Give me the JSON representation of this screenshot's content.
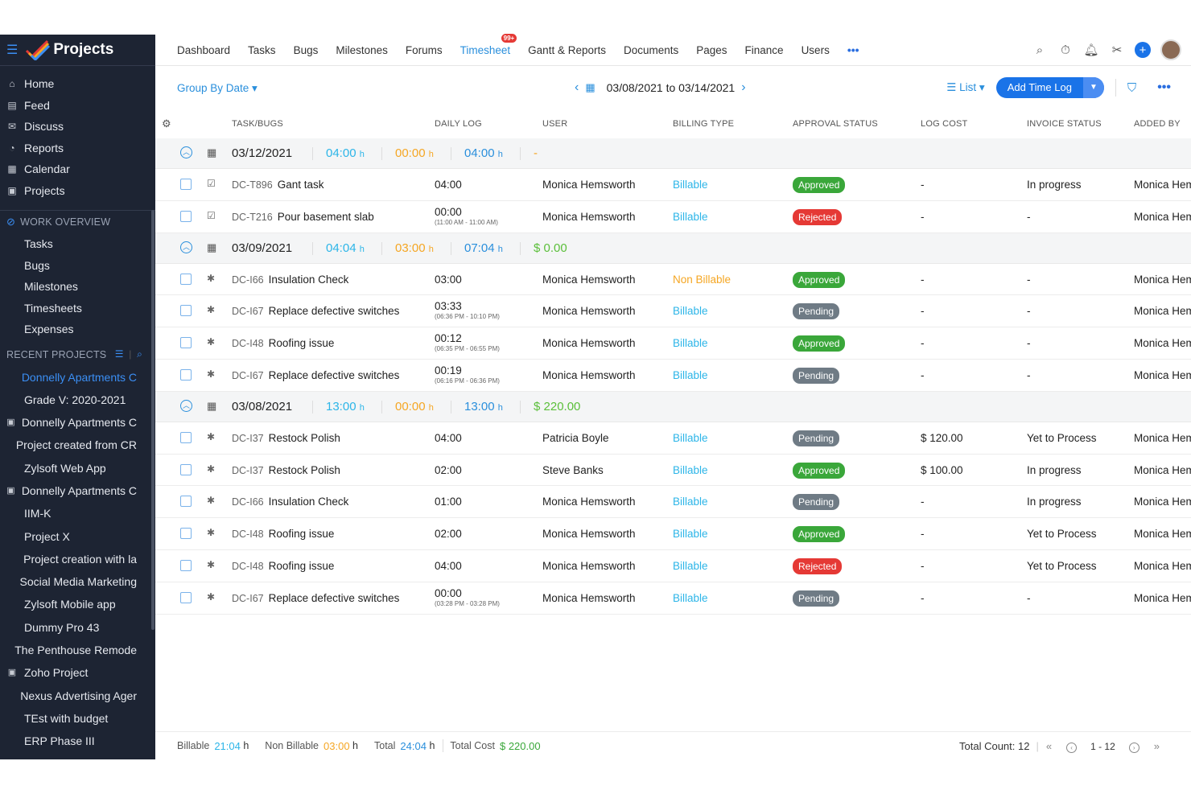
{
  "app": {
    "title": "Projects"
  },
  "sidebar": {
    "main_items": [
      {
        "icon": "home-icon",
        "label": "Home"
      },
      {
        "icon": "feed-icon",
        "label": "Feed"
      },
      {
        "icon": "discuss-icon",
        "label": "Discuss"
      },
      {
        "icon": "reports-icon",
        "label": "Reports"
      },
      {
        "icon": "calendar-icon",
        "label": "Calendar"
      },
      {
        "icon": "projects-icon",
        "label": "Projects"
      }
    ],
    "work_overview_label": "WORK OVERVIEW",
    "work_items": [
      "Tasks",
      "Bugs",
      "Milestones",
      "Timesheets",
      "Expenses"
    ],
    "recent_projects_label": "RECENT PROJECTS",
    "recent_projects": [
      {
        "label": "Donnelly Apartments C",
        "icon": "",
        "active": true
      },
      {
        "label": "Grade V: 2020-2021",
        "icon": ""
      },
      {
        "label": "Donnelly Apartments C",
        "icon": "project-icon"
      },
      {
        "label": "Project created from CR",
        "icon": ""
      },
      {
        "label": "Zylsoft Web App",
        "icon": ""
      },
      {
        "label": "Donnelly Apartments C",
        "icon": "project-icon"
      },
      {
        "label": "IIM-K",
        "icon": ""
      },
      {
        "label": "Project X",
        "icon": ""
      },
      {
        "label": "Project creation with la",
        "icon": ""
      },
      {
        "label": "Social Media Marketing",
        "icon": ""
      },
      {
        "label": "Zylsoft Mobile app",
        "icon": ""
      },
      {
        "label": "Dummy Pro 43",
        "icon": ""
      },
      {
        "label": "The Penthouse Remode",
        "icon": ""
      },
      {
        "label": "Zoho Project",
        "icon": "project-icon"
      },
      {
        "label": "Nexus Advertising Ager",
        "icon": ""
      },
      {
        "label": "TEst with budget",
        "icon": ""
      },
      {
        "label": "ERP Phase III",
        "icon": ""
      }
    ]
  },
  "topnav": {
    "tabs": [
      "Dashboard",
      "Tasks",
      "Bugs",
      "Milestones",
      "Forums",
      "Timesheet",
      "Gantt & Reports",
      "Documents",
      "Pages",
      "Finance",
      "Users"
    ],
    "active_tab": "Timesheet",
    "timesheet_badge": "99+",
    "more": "•••"
  },
  "toolbar": {
    "group_by": "Group By Date ▾",
    "date_range": "03/08/2021 to 03/14/2021",
    "view": "List ▾",
    "add_button": "Add Time Log",
    "more": "•••"
  },
  "table": {
    "columns": [
      "TASK/BUGS",
      "DAILY LOG",
      "USER",
      "BILLING TYPE",
      "APPROVAL STATUS",
      "LOG COST",
      "INVOICE STATUS",
      "ADDED BY"
    ],
    "groups": [
      {
        "date": "03/12/2021",
        "billable": "04:00",
        "non_billable": "00:00",
        "total": "04:00",
        "cost": "-",
        "rows": [
          {
            "icon": "task-icon",
            "id": "DC-T896",
            "name": "Gant task",
            "log": "04:00",
            "log_range": "",
            "user": "Monica Hemsworth",
            "billing": "Billable",
            "approval": "Approved",
            "cost": "-",
            "invoice": "In progress",
            "added_by": "Monica Hemsworth"
          },
          {
            "icon": "task-icon",
            "id": "DC-T216",
            "name": "Pour basement slab",
            "log": "00:00",
            "log_range": "(11:00 AM - 11:00 AM)",
            "user": "Monica Hemsworth",
            "billing": "Billable",
            "approval": "Rejected",
            "cost": "-",
            "invoice": "-",
            "added_by": "Monica Hemsworth"
          }
        ]
      },
      {
        "date": "03/09/2021",
        "billable": "04:04",
        "non_billable": "03:00",
        "total": "07:04",
        "cost": "$ 0.00",
        "rows": [
          {
            "icon": "bug-icon",
            "id": "DC-I66",
            "name": "Insulation Check",
            "log": "03:00",
            "log_range": "",
            "user": "Monica Hemsworth",
            "billing": "Non Billable",
            "approval": "Approved",
            "cost": "-",
            "invoice": "-",
            "added_by": "Monica Hemsworth"
          },
          {
            "icon": "bug-icon",
            "id": "DC-I67",
            "name": "Replace defective switches",
            "log": "03:33",
            "log_range": "(06:36 PM - 10:10 PM)",
            "user": "Monica Hemsworth",
            "billing": "Billable",
            "approval": "Pending",
            "cost": "-",
            "invoice": "-",
            "added_by": "Monica Hemsworth"
          },
          {
            "icon": "bug-icon",
            "id": "DC-I48",
            "name": "Roofing issue",
            "log": "00:12",
            "log_range": "(06:35 PM - 06:55 PM)",
            "user": "Monica Hemsworth",
            "billing": "Billable",
            "approval": "Approved",
            "cost": "-",
            "invoice": "-",
            "added_by": "Monica Hemsworth"
          },
          {
            "icon": "bug-icon",
            "id": "DC-I67",
            "name": "Replace defective switches",
            "log": "00:19",
            "log_range": "(06:16 PM - 06:36 PM)",
            "user": "Monica Hemsworth",
            "billing": "Billable",
            "approval": "Pending",
            "cost": "-",
            "invoice": "-",
            "added_by": "Monica Hemsworth"
          }
        ]
      },
      {
        "date": "03/08/2021",
        "billable": "13:00",
        "non_billable": "00:00",
        "total": "13:00",
        "cost": "$ 220.00",
        "rows": [
          {
            "icon": "bug-icon",
            "id": "DC-I37",
            "name": "Restock Polish",
            "log": "04:00",
            "log_range": "",
            "user": "Patricia Boyle",
            "billing": "Billable",
            "approval": "Pending",
            "cost": "$ 120.00",
            "invoice": "Yet to Process",
            "added_by": "Monica Hemsworth"
          },
          {
            "icon": "bug-icon",
            "id": "DC-I37",
            "name": "Restock Polish",
            "log": "02:00",
            "log_range": "",
            "user": "Steve Banks",
            "billing": "Billable",
            "approval": "Approved",
            "cost": "$ 100.00",
            "invoice": "In progress",
            "added_by": "Monica Hemsworth"
          },
          {
            "icon": "bug-icon",
            "id": "DC-I66",
            "name": "Insulation Check",
            "log": "01:00",
            "log_range": "",
            "user": "Monica Hemsworth",
            "billing": "Billable",
            "approval": "Pending",
            "cost": "-",
            "invoice": "In progress",
            "added_by": "Monica Hemsworth"
          },
          {
            "icon": "bug-icon",
            "id": "DC-I48",
            "name": "Roofing issue",
            "log": "02:00",
            "log_range": "",
            "user": "Monica Hemsworth",
            "billing": "Billable",
            "approval": "Approved",
            "cost": "-",
            "invoice": "Yet to Process",
            "added_by": "Monica Hemsworth"
          },
          {
            "icon": "bug-icon",
            "id": "DC-I48",
            "name": "Roofing issue",
            "log": "04:00",
            "log_range": "",
            "user": "Monica Hemsworth",
            "billing": "Billable",
            "approval": "Rejected",
            "cost": "-",
            "invoice": "Yet to Process",
            "added_by": "Monica Hemsworth"
          },
          {
            "icon": "bug-icon",
            "id": "DC-I67",
            "name": "Replace defective switches",
            "log": "00:00",
            "log_range": "(03:28 PM - 03:28 PM)",
            "user": "Monica Hemsworth",
            "billing": "Billable",
            "approval": "Pending",
            "cost": "-",
            "invoice": "-",
            "added_by": "Monica Hemsworth"
          }
        ]
      }
    ]
  },
  "footer": {
    "billable_label": "Billable",
    "billable": "21:04",
    "non_billable_label": "Non Billable",
    "non_billable": "03:00",
    "total_label": "Total",
    "total": "24:04",
    "total_cost_label": "Total Cost",
    "total_cost": "$ 220.00",
    "hours_unit": "h",
    "total_count": "Total Count: 12",
    "page_range": "1 - 12"
  },
  "colors": {
    "accent": "#2a8fdc",
    "sidebar_bg": "#1d2433",
    "billable": "#2cb5e8",
    "non_billable": "#f5a623",
    "cost": "#5bbf3a",
    "approved": "#3aa73a",
    "rejected": "#e53935",
    "pending": "#6f7b85"
  }
}
